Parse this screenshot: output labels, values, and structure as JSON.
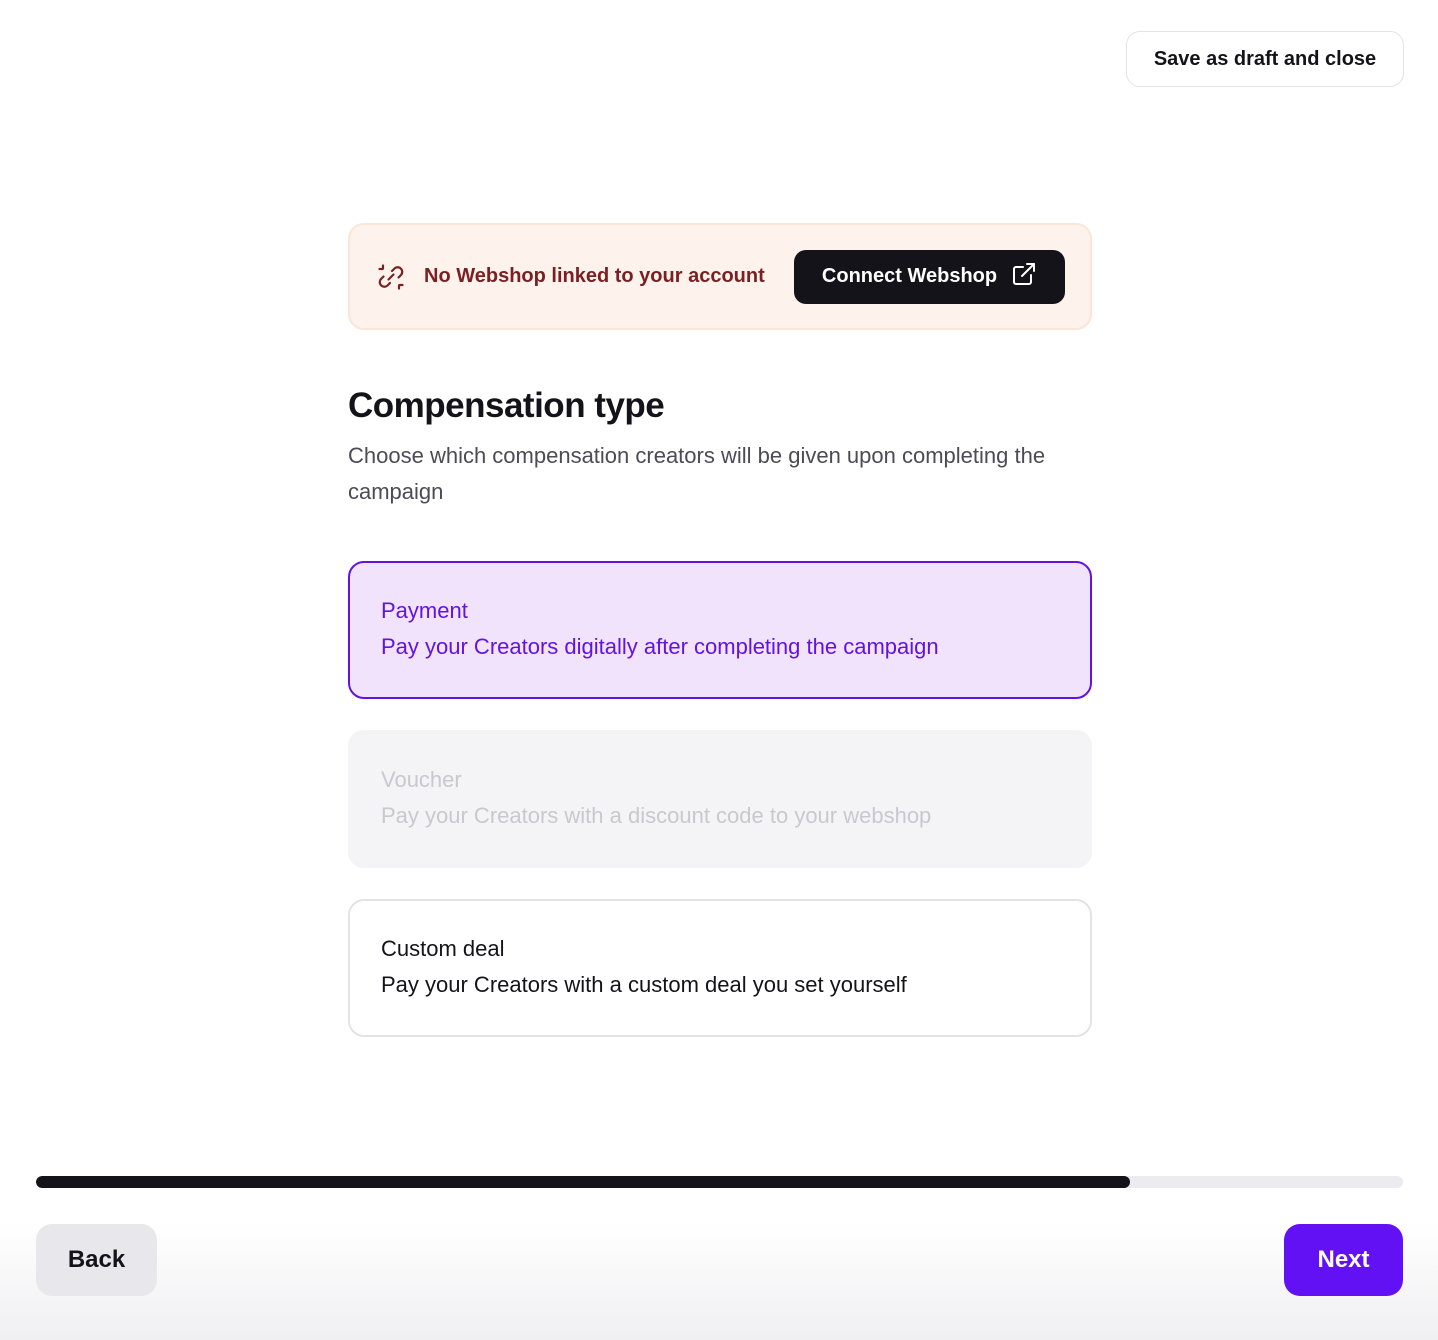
{
  "header": {
    "save_draft_label": "Save as draft and close"
  },
  "alert": {
    "icon": "unlink-icon",
    "message": "No Webshop linked to your account",
    "button_label": "Connect Webshop",
    "button_icon": "external-link-icon",
    "background_color": "#fdf3ec",
    "text_color": "#7a1f22"
  },
  "section": {
    "title": "Compensation type",
    "description": "Choose which compensation creators will be given upon completing the campaign"
  },
  "options": [
    {
      "title": "Payment",
      "subtitle": "Pay your Creators digitally after completing the campaign",
      "state": "selected"
    },
    {
      "title": "Voucher",
      "subtitle": "Pay your Creators with a discount code to your webshop",
      "state": "disabled"
    },
    {
      "title": "Custom deal",
      "subtitle": "Pay your Creators with a custom deal you set yourself",
      "state": "default"
    }
  ],
  "progress": {
    "fraction": 0.8
  },
  "footer": {
    "back_label": "Back",
    "next_label": "Next"
  },
  "colors": {
    "accent": "#6211f4",
    "selected_bg": "#f1e3fc",
    "dark": "#14131a"
  }
}
